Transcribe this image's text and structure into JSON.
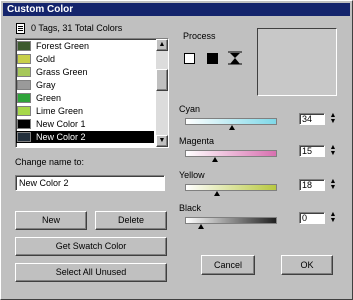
{
  "window": {
    "title": "Custom Color"
  },
  "list": {
    "header": "0 Tags, 31 Total Colors",
    "items": [
      {
        "label": "Forest Green",
        "color": "#3d5b2e",
        "selected": false
      },
      {
        "label": "Gold",
        "color": "#c8d04a",
        "selected": false
      },
      {
        "label": "Grass Green",
        "color": "#a6c85a",
        "selected": false
      },
      {
        "label": "Gray",
        "color": "#9a9a9a",
        "selected": false
      },
      {
        "label": "Green",
        "color": "#2fa43a",
        "selected": false
      },
      {
        "label": "Lime Green",
        "color": "#a6d84a",
        "selected": false
      },
      {
        "label": "New Color 1",
        "color": "#000000",
        "selected": false
      },
      {
        "label": "New Color 2",
        "color": "#24303c",
        "selected": true
      }
    ]
  },
  "rename": {
    "label": "Change name to:",
    "value": "New Color 2"
  },
  "buttons": {
    "new": "New",
    "delete": "Delete",
    "get_swatch": "Get Swatch Color",
    "select_unused": "Select All Unused",
    "cancel": "Cancel",
    "ok": "OK"
  },
  "process": {
    "label": "Process"
  },
  "channels": [
    {
      "label": "Cyan",
      "value": "34",
      "slider_level": 0.34,
      "gradient_end": "#7fd8e8"
    },
    {
      "label": "Magenta",
      "value": "15",
      "slider_level": 0.15,
      "gradient_end": "#d870b0"
    },
    {
      "label": "Yellow",
      "value": "18",
      "slider_level": 0.18,
      "gradient_end": "#b8c840"
    },
    {
      "label": "Black",
      "value": "0",
      "slider_level": 0.0,
      "gradient_end": "#202020"
    }
  ]
}
